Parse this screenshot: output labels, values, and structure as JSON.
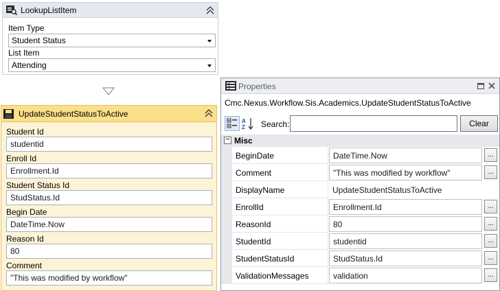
{
  "lookup_card": {
    "title": "LookupListItem",
    "fields": [
      {
        "label": "Item Type",
        "value": "Student Status"
      },
      {
        "label": "List Item",
        "value": "Attending"
      }
    ]
  },
  "update_card": {
    "title": "UpdateStudentStatusToActive",
    "fields": [
      {
        "label": "Student Id",
        "value": "studentid"
      },
      {
        "label": "Enroll Id",
        "value": "Enrollment.Id"
      },
      {
        "label": "Student Status Id",
        "value": "StudStatus.Id"
      },
      {
        "label": "Begin Date",
        "value": "DateTime.Now"
      },
      {
        "label": "Reason Id",
        "value": "80"
      },
      {
        "label": "Comment",
        "value": "\"This was modified by workflow\""
      }
    ]
  },
  "properties": {
    "title": "Properties",
    "type_name": "Cmc.Nexus.Workflow.Sis.Academics.UpdateStudentStatusToActive",
    "search_label": "Search:",
    "search_value": "",
    "clear_label": "Clear",
    "category": "Misc",
    "category_toggle": "−",
    "ellipsis": "...",
    "rows": [
      {
        "name": "BeginDate",
        "value": "DateTime.Now",
        "editable": true
      },
      {
        "name": "Comment",
        "value": "\"This was modified by workflow\"",
        "editable": true
      },
      {
        "name": "DisplayName",
        "value": "UpdateStudentStatusToActive",
        "editable": false
      },
      {
        "name": "EnrollId",
        "value": "Enrollment.Id",
        "editable": true
      },
      {
        "name": "ReasonId",
        "value": "80",
        "editable": true
      },
      {
        "name": "StudentId",
        "value": "studentid",
        "editable": true
      },
      {
        "name": "StudentStatusId",
        "value": "StudStatus.Id",
        "editable": true
      },
      {
        "name": "ValidationMessages",
        "value": "validation",
        "editable": true
      }
    ]
  },
  "colors": {
    "selected_activity_header": "#fbdf8a",
    "selected_activity_body": "#fdf3d6",
    "activity_header": "#e3e8f1"
  }
}
